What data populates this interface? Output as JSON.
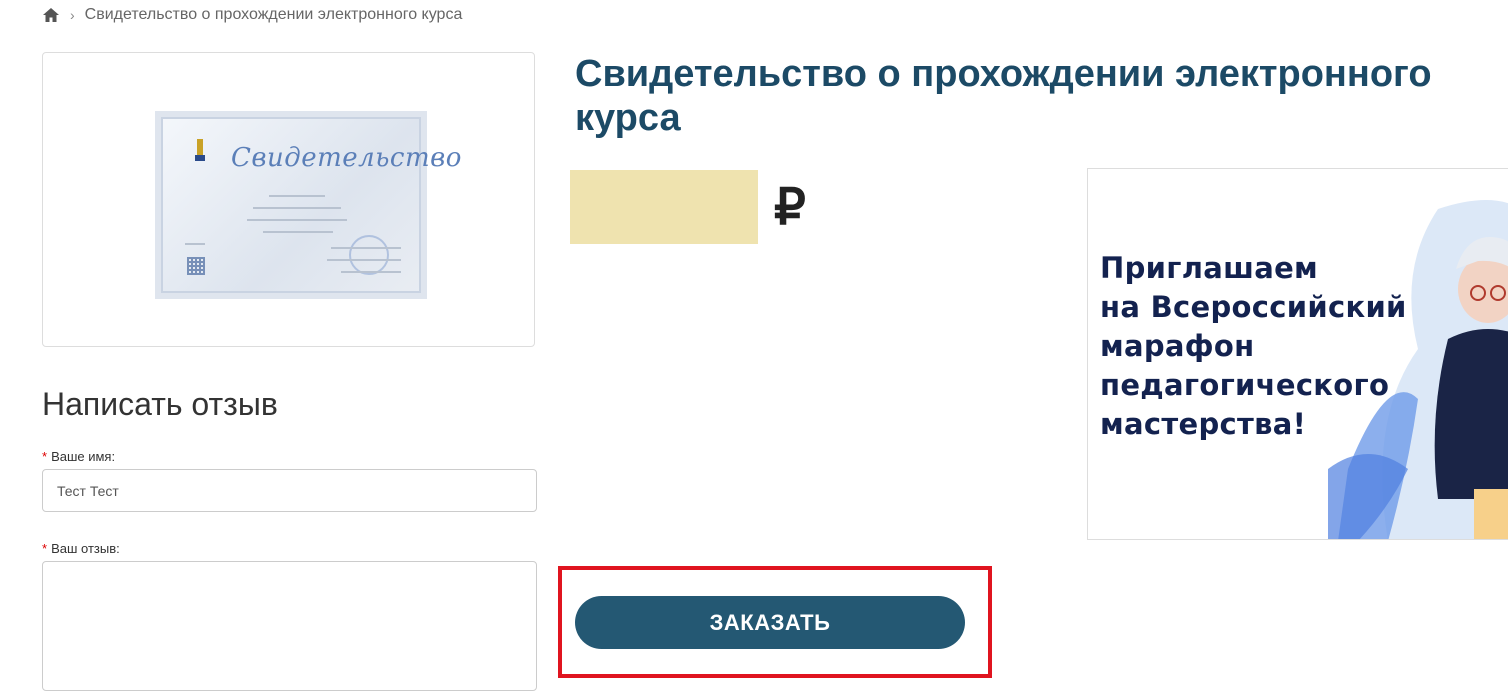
{
  "breadcrumb": {
    "home_icon": "home-icon",
    "separator_icon": "chevron-right-icon",
    "current": "Свидетельство о прохождении электронного курса"
  },
  "product_image": {
    "cert_title": "Свидетельство"
  },
  "review": {
    "heading": "Написать отзыв",
    "required_mark": "*",
    "name_label": "Ваше имя:",
    "name_value": "Тест Тест",
    "review_label": "Ваш отзыв:",
    "review_value": ""
  },
  "product": {
    "title": "Свидетельство о прохождении электронного курса",
    "currency": "₽"
  },
  "banner": {
    "text": "Приглашаем\nна Всероссийский\nмарафон\nпедагогического\nмастерства!"
  },
  "order_button": {
    "label": "ЗАКАЗАТЬ"
  },
  "colors": {
    "title": "#1c4a66",
    "button": "#245873",
    "highlight": "#e0141f",
    "price_mask": "#efe3af",
    "banner_text": "#13224f"
  }
}
